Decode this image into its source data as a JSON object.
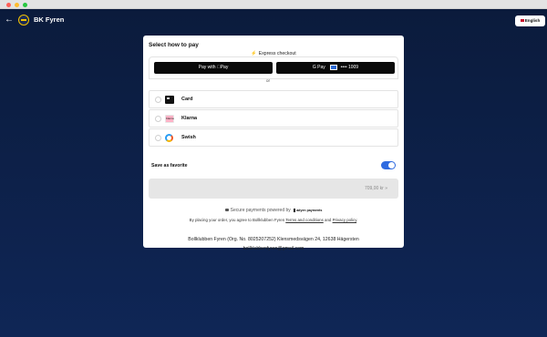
{
  "header": {
    "brand": "BK Fyren",
    "language": "English"
  },
  "checkout": {
    "title": "Select how to pay",
    "express_label": "Express checkout",
    "apple_pay_label": "Pay with Pay",
    "google_pay_label": "G Pay",
    "google_pay_card": "•••• 1009",
    "divider": "or",
    "methods": [
      {
        "label": "Card",
        "icon": "card-icon"
      },
      {
        "label": "Klarna",
        "icon": "klarna-icon",
        "icon_text": "Klarna"
      },
      {
        "label": "Swish",
        "icon": "swish-icon"
      }
    ],
    "save_favorite": "Save as favorite",
    "save_favorite_on": true,
    "pay_amount": "709,00 kr »",
    "secure_text": "Secure payments powered by",
    "adyen_label": "adyen payments",
    "terms_prefix": "By placing your order, you agree to Bollklubben Fyren",
    "terms_link": "Terms and conditions",
    "terms_and": "and",
    "privacy_link": "Privacy policy",
    "org_line": "Bollklubben Fyren (Org. No. 8025207252)  Klensmedsvägen 24, 12638 Hägersten",
    "email": "bollklubbenfyren@gmail.com"
  },
  "colors": {
    "background": "#0c1f45",
    "accent": "#2f6be0"
  }
}
